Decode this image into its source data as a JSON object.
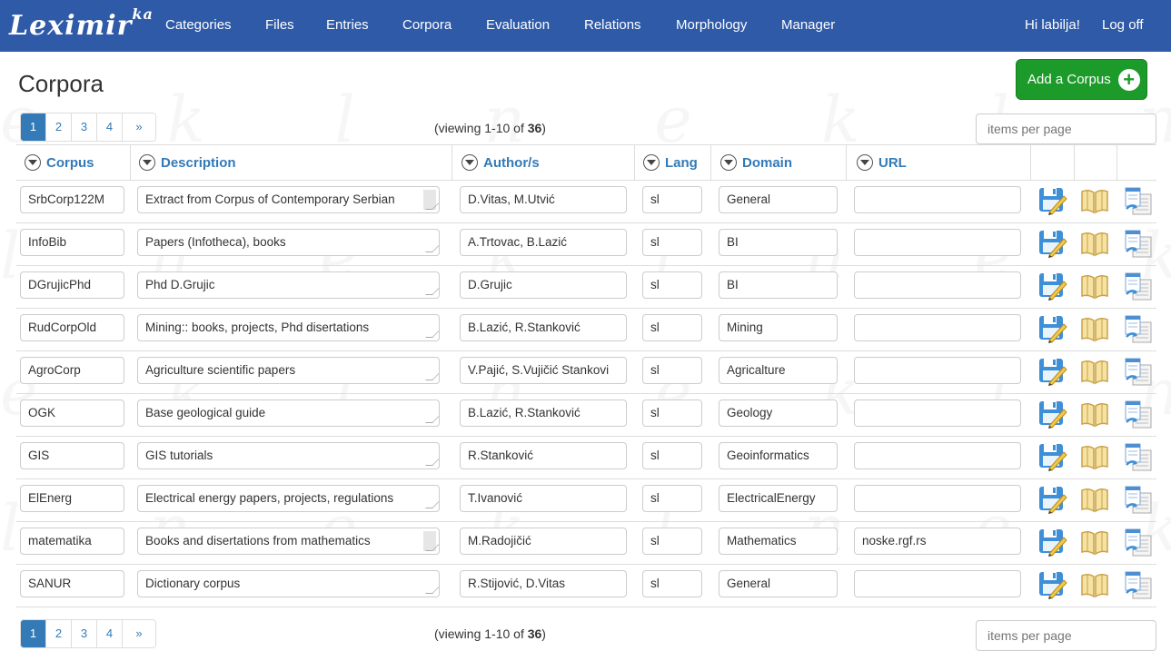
{
  "brand": {
    "name": "Leximir",
    "sup": "ka"
  },
  "nav": {
    "items": [
      "Categories",
      "Files",
      "Entries",
      "Corpora",
      "Evaluation",
      "Relations",
      "Morphology",
      "Manager"
    ],
    "greeting": "Hi labilja!",
    "logoff": "Log off"
  },
  "page": {
    "title": "Corpora",
    "add_button": "Add a Corpus"
  },
  "pagination": {
    "pages": [
      "1",
      "2",
      "3",
      "4",
      "»"
    ],
    "viewing_prefix": "(viewing 1-10 of ",
    "viewing_total": "36",
    "viewing_suffix": ")",
    "items_per_page_placeholder": "items per page"
  },
  "table": {
    "headers": [
      "Corpus",
      "Description",
      "Author/s",
      "Lang",
      "Domain",
      "URL"
    ],
    "rows": [
      {
        "corpus": "SrbCorp122M",
        "description": "Extract from Corpus of Contemporary Serbian",
        "authors": "D.Vitas, M.Utvić",
        "lang": "sl",
        "domain": "General",
        "url": ""
      },
      {
        "corpus": "InfoBib",
        "description": "Papers (Infotheca), books",
        "authors": "A.Trtovac, B.Lazić",
        "lang": "sl",
        "domain": "BI",
        "url": ""
      },
      {
        "corpus": "DGrujicPhd",
        "description": "Phd D.Grujic",
        "authors": "D.Grujic",
        "lang": "sl",
        "domain": "BI",
        "url": ""
      },
      {
        "corpus": "RudCorpOld",
        "description": "Mining:: books, projects, Phd disertations",
        "authors": "B.Lazić, R.Stanković",
        "lang": "sl",
        "domain": "Mining",
        "url": ""
      },
      {
        "corpus": "AgroCorp",
        "description": "Agriculture scientific papers",
        "authors": "V.Pajić, S.Vujičić Stankovi",
        "lang": "sl",
        "domain": "Agricalture",
        "url": ""
      },
      {
        "corpus": "OGK",
        "description": "Base geological guide",
        "authors": "B.Lazić, R.Stanković",
        "lang": "sl",
        "domain": "Geology",
        "url": ""
      },
      {
        "corpus": "GIS",
        "description": "GIS tutorials",
        "authors": "R.Stanković",
        "lang": "sl",
        "domain": "Geoinformatics",
        "url": ""
      },
      {
        "corpus": "ElEnerg",
        "description": "Electrical energy papers, projects, regulations",
        "authors": "T.Ivanović",
        "lang": "sl",
        "domain": "ElectricalEnergy",
        "url": ""
      },
      {
        "corpus": "matematika",
        "description": "Books and disertations from mathematics",
        "authors": "M.Radojičić",
        "lang": "sl",
        "domain": "Mathematics",
        "url": "noske.rgf.rs"
      },
      {
        "corpus": "SANUR",
        "description": "Dictionary corpus",
        "authors": "R.Stijović, D.Vitas",
        "lang": "sl",
        "domain": "General",
        "url": ""
      }
    ],
    "scroll_rows": [
      0,
      8
    ],
    "action_icons": [
      "save-edit-icon",
      "open-book-icon",
      "document-list-icon"
    ]
  },
  "colors": {
    "navbar": "#2e5aa8",
    "accent": "#337ab7",
    "add_button": "#1d9b2a"
  }
}
